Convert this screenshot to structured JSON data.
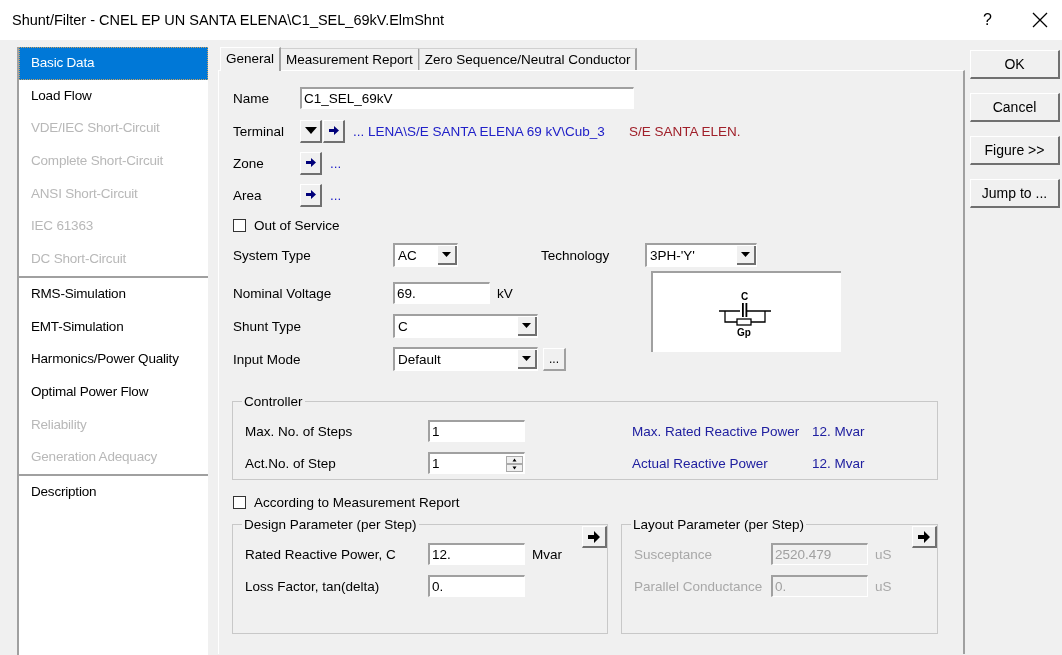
{
  "window": {
    "title": "Shunt/Filter - CNEL EP UN SANTA ELENA\\C1_SEL_69kV.ElmShnt",
    "help": "?"
  },
  "sidebar": {
    "groups": [
      {
        "items": [
          {
            "label": "Basic Data",
            "selected": true,
            "disabled": false
          },
          {
            "label": "Load Flow",
            "selected": false,
            "disabled": false
          },
          {
            "label": "VDE/IEC Short-Circuit",
            "selected": false,
            "disabled": true
          },
          {
            "label": "Complete Short-Circuit",
            "selected": false,
            "disabled": true
          },
          {
            "label": "ANSI Short-Circuit",
            "selected": false,
            "disabled": true
          },
          {
            "label": "IEC 61363",
            "selected": false,
            "disabled": true
          },
          {
            "label": "DC Short-Circuit",
            "selected": false,
            "disabled": true
          }
        ]
      },
      {
        "items": [
          {
            "label": "RMS-Simulation",
            "selected": false,
            "disabled": false
          },
          {
            "label": "EMT-Simulation",
            "selected": false,
            "disabled": false
          },
          {
            "label": "Harmonics/Power Quality",
            "selected": false,
            "disabled": false
          },
          {
            "label": "Optimal Power Flow",
            "selected": false,
            "disabled": false
          },
          {
            "label": "Reliability",
            "selected": false,
            "disabled": true
          },
          {
            "label": "Generation Adequacy",
            "selected": false,
            "disabled": true
          }
        ]
      },
      {
        "items": [
          {
            "label": "Description",
            "selected": false,
            "disabled": false
          }
        ]
      }
    ]
  },
  "tabs": [
    {
      "label": "General",
      "selected": true
    },
    {
      "label": "Measurement Report",
      "selected": false
    },
    {
      "label": "Zero Sequence/Neutral Conductor",
      "selected": false
    }
  ],
  "general": {
    "name": {
      "label": "Name",
      "value": "C1_SEL_69kV"
    },
    "terminal": {
      "label": "Terminal",
      "path": "... LENA\\S/E SANTA ELENA 69 kV\\Cub_3",
      "node": "S/E SANTA ELEN."
    },
    "zone": {
      "label": "Zone",
      "path": "..."
    },
    "area": {
      "label": "Area",
      "path": "..."
    },
    "out_of_service": {
      "label": "Out of Service",
      "checked": false
    },
    "system_type": {
      "label": "System Type",
      "value": "AC"
    },
    "technology": {
      "label": "Technology",
      "value": "3PH-'Y'"
    },
    "nominal_voltage": {
      "label": "Nominal Voltage",
      "value": "69.",
      "unit": "kV"
    },
    "shunt_type": {
      "label": "Shunt Type",
      "value": "C"
    },
    "input_mode": {
      "label": "Input Mode",
      "value": "Default",
      "button": "..."
    },
    "diagram": {
      "top_label": "C",
      "bottom_label": "Gp"
    },
    "controller": {
      "title": "Controller",
      "rows": [
        {
          "kind": "text",
          "label": "Max. No. of Steps",
          "value": "1",
          "info_label": "Max. Rated Reactive Power",
          "info_value": "12. Mvar"
        },
        {
          "kind": "spin",
          "label": "Act.No. of Step",
          "value": "1",
          "info_label": "Actual Reactive Power",
          "info_value": "12. Mvar"
        }
      ]
    },
    "according": {
      "label": "According to Measurement Report",
      "checked": false
    },
    "design": {
      "title": "Design Parameter (per Step)",
      "disabled": false,
      "rows": [
        {
          "label": "Rated Reactive Power, C",
          "value": "12.",
          "unit": "Mvar"
        },
        {
          "label": "Loss Factor, tan(delta)",
          "value": "0."
        }
      ]
    },
    "layout": {
      "title": "Layout Parameter (per Step)",
      "disabled": true,
      "rows": [
        {
          "label": "Susceptance",
          "value": "2520.479",
          "unit": "uS"
        },
        {
          "label": "Parallel Conductance",
          "value": "0.",
          "unit": "uS"
        }
      ]
    }
  },
  "buttons": [
    "OK",
    "Cancel",
    "Figure >>",
    "Jump to ..."
  ]
}
